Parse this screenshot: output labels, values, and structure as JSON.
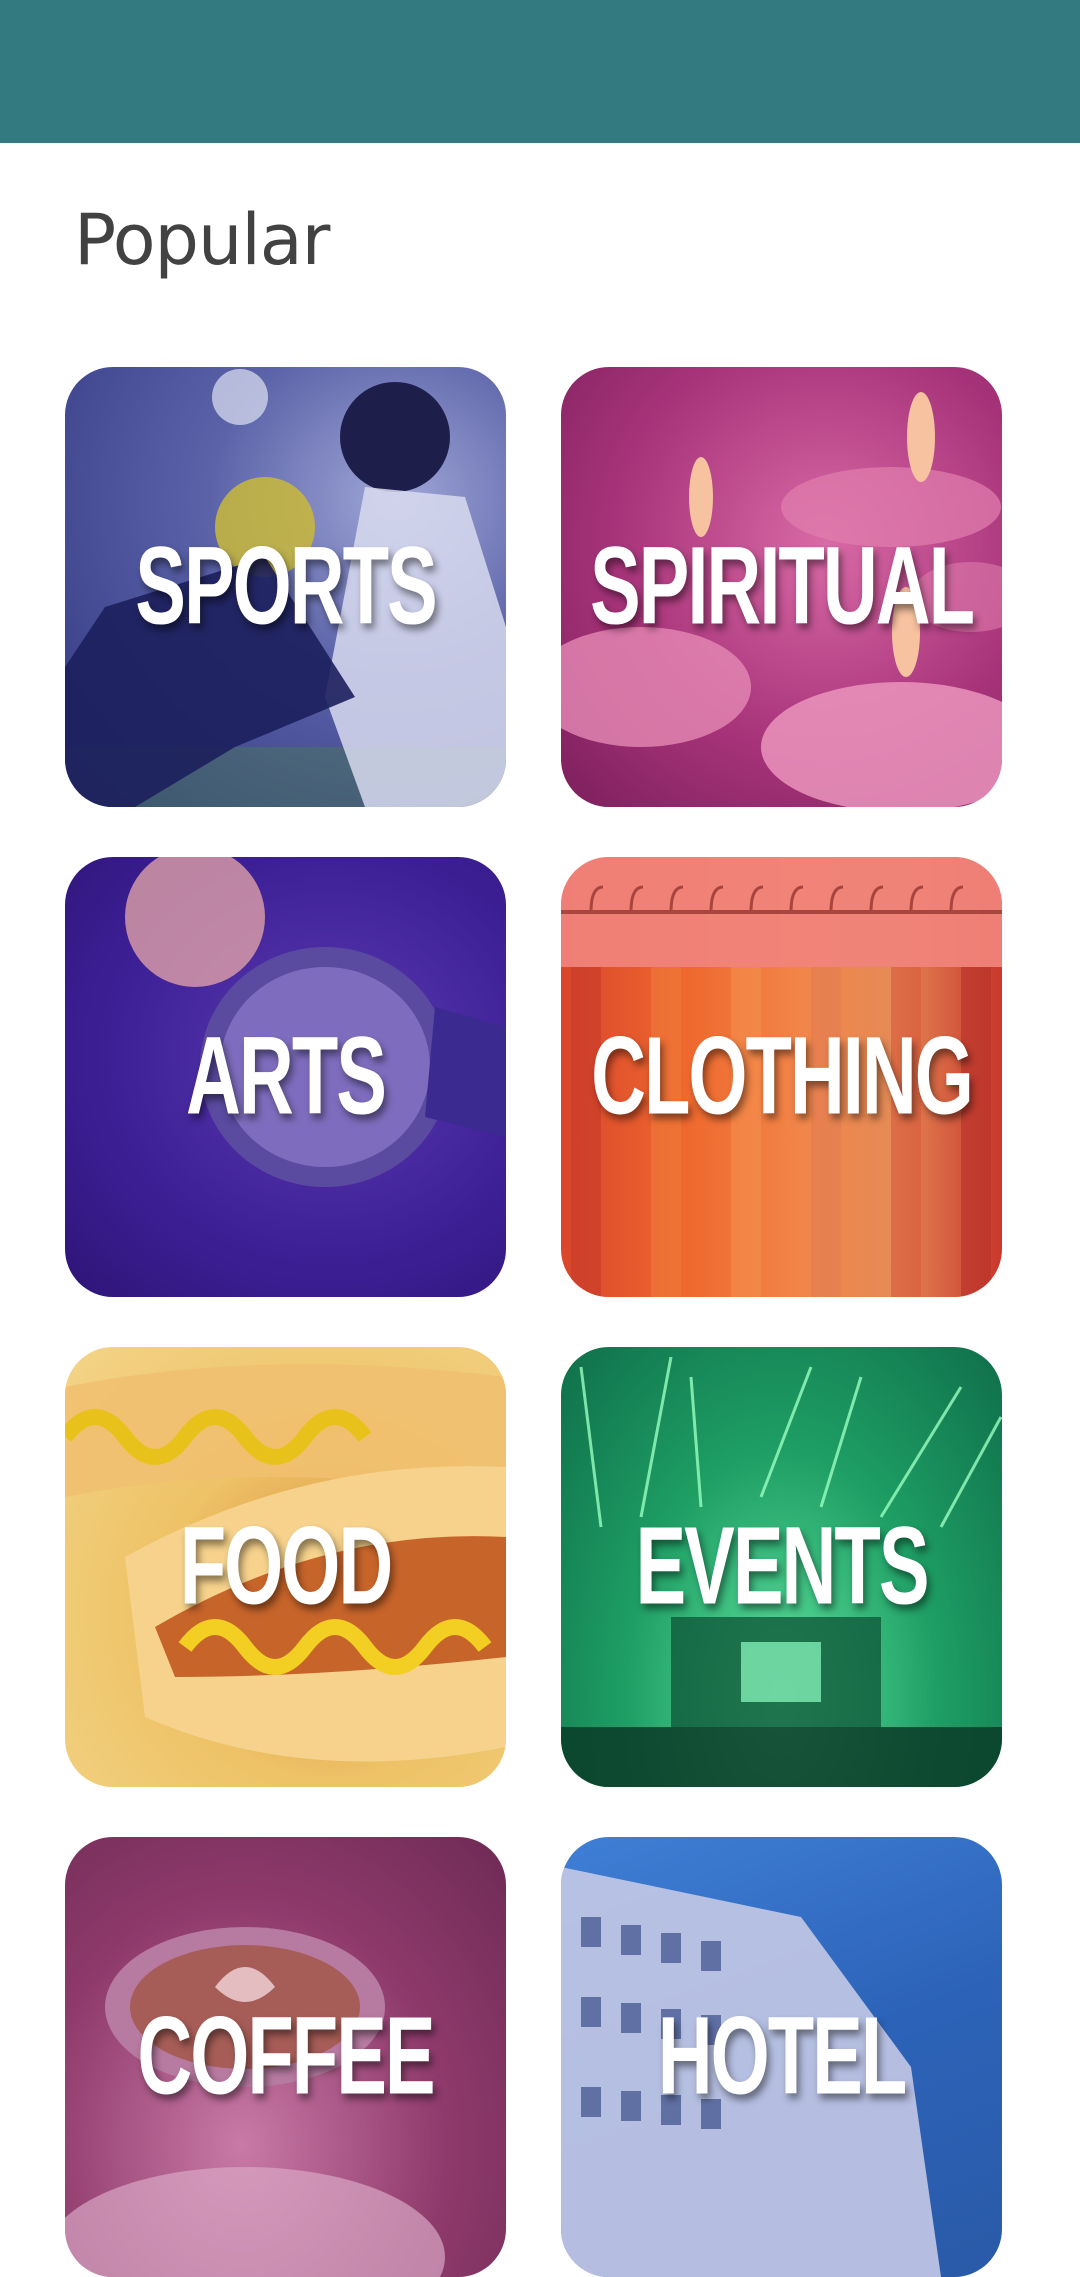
{
  "header": {
    "color": "#327a80"
  },
  "section": {
    "title": "Popular"
  },
  "categories": [
    {
      "label": "SPORTS",
      "color": "#5b62a8"
    },
    {
      "label": "SPIRITUAL",
      "color": "#a8347a"
    },
    {
      "label": "ARTS",
      "color": "#3d1f95"
    },
    {
      "label": "CLOTHING",
      "color": "#ef6a2f"
    },
    {
      "label": "FOOD",
      "color": "#eec266"
    },
    {
      "label": "EVENTS",
      "color": "#1e9e64"
    },
    {
      "label": "COFFEE",
      "color": "#8e3a6b"
    },
    {
      "label": "HOTEL",
      "color": "#2c63b8"
    }
  ]
}
